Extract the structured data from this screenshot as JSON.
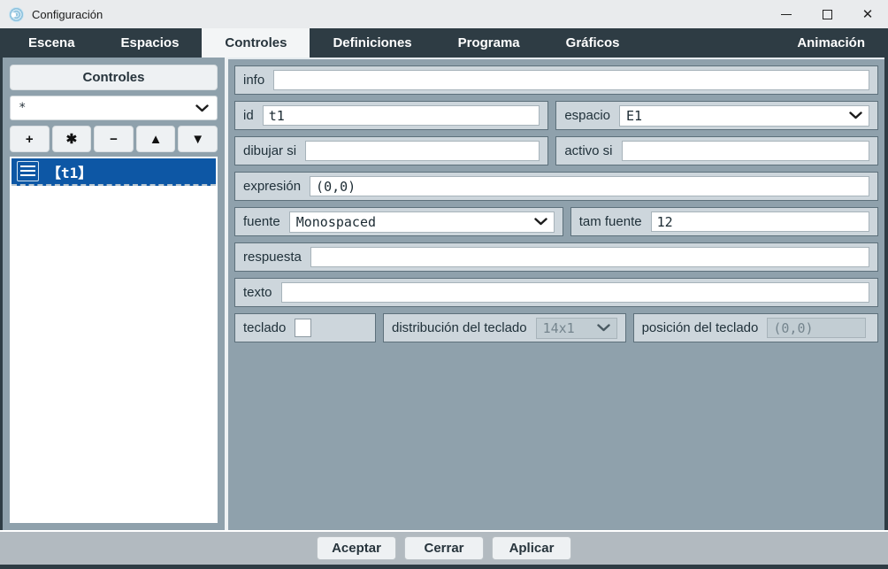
{
  "titlebar": {
    "title": "Configuración",
    "close_glyph": "✕"
  },
  "tabs": [
    {
      "label": "Escena",
      "active": false
    },
    {
      "label": "Espacios",
      "active": false
    },
    {
      "label": "Controles",
      "active": true
    },
    {
      "label": "Definiciones",
      "active": false
    },
    {
      "label": "Programa",
      "active": false
    },
    {
      "label": "Gráficos",
      "active": false
    },
    {
      "label": "Animación",
      "active": false
    }
  ],
  "sidebar": {
    "header": "Controles",
    "filter": {
      "value": "*"
    },
    "toolbar": {
      "add": "+",
      "asterisk": "✱",
      "remove": "−",
      "up": "▲",
      "down": "▼"
    },
    "list": [
      {
        "label": "【t1】",
        "selected": true
      }
    ]
  },
  "form": {
    "info": {
      "label": "info",
      "value": ""
    },
    "id": {
      "label": "id",
      "value": "t1"
    },
    "espacio": {
      "label": "espacio",
      "value": "E1"
    },
    "dibujar_si": {
      "label": "dibujar si",
      "value": ""
    },
    "activo_si": {
      "label": "activo si",
      "value": ""
    },
    "expresion": {
      "label": "expresión",
      "value": "(0,0)"
    },
    "fuente": {
      "label": "fuente",
      "value": "Monospaced"
    },
    "tam_fuente": {
      "label": "tam fuente",
      "value": "12"
    },
    "respuesta": {
      "label": "respuesta",
      "value": ""
    },
    "texto": {
      "label": "texto",
      "value": ""
    },
    "teclado": {
      "label": "teclado",
      "checked": false
    },
    "distribucion_teclado": {
      "label": "distribución del teclado",
      "value": "14x1",
      "disabled": true
    },
    "posicion_teclado": {
      "label": "posición del teclado",
      "value": "(0,0)",
      "disabled": true
    }
  },
  "footer": {
    "accept": "Aceptar",
    "close": "Cerrar",
    "apply": "Aplicar"
  },
  "colors": {
    "accent_blue": "#0d57a5",
    "dark_frame": "#2e3c44",
    "panel": "#8fa1ac",
    "row": "#cdd6dc"
  }
}
